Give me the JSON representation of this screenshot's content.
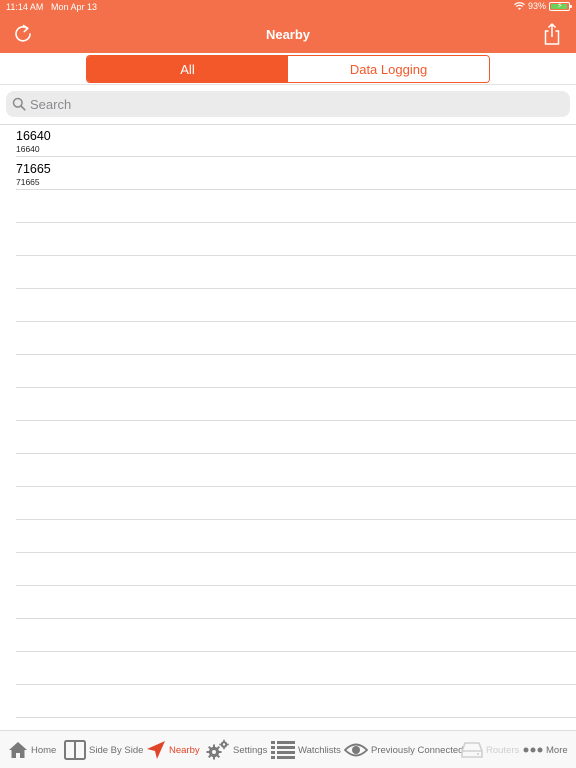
{
  "status_bar": {
    "time": "11:14 AM",
    "date": "Mon Apr 13",
    "battery": "93%",
    "battery_level": 0.93
  },
  "nav": {
    "title": "Nearby",
    "left_icon": "refresh-icon",
    "right_icon": "share-icon"
  },
  "segments": {
    "items": [
      {
        "label": "All",
        "selected": true
      },
      {
        "label": "Data Logging",
        "selected": false
      }
    ]
  },
  "search": {
    "placeholder": "Search",
    "value": ""
  },
  "list": {
    "rows": [
      {
        "title": "16640",
        "subtitle": "16640"
      },
      {
        "title": "71665",
        "subtitle": "71665"
      }
    ],
    "empty_rows": 17
  },
  "tabbar": {
    "items": [
      {
        "label": "Home",
        "icon": "home-icon",
        "state": "normal"
      },
      {
        "label": "Side By Side",
        "icon": "side-by-side-icon",
        "state": "normal"
      },
      {
        "label": "Nearby",
        "icon": "location-arrow-icon",
        "state": "active"
      },
      {
        "label": "Settings",
        "icon": "gears-icon",
        "state": "normal"
      },
      {
        "label": "Watchlists",
        "icon": "list-icon",
        "state": "normal"
      },
      {
        "label": "Previously Connected",
        "icon": "eye-icon",
        "state": "normal"
      },
      {
        "label": "Routers",
        "icon": "router-icon",
        "state": "disabled"
      },
      {
        "label": "More",
        "icon": "more-dots-icon",
        "state": "normal"
      }
    ]
  },
  "colors": {
    "header": "#F3704A",
    "accent": "#F3582B",
    "tab_active": "#E0452A"
  }
}
